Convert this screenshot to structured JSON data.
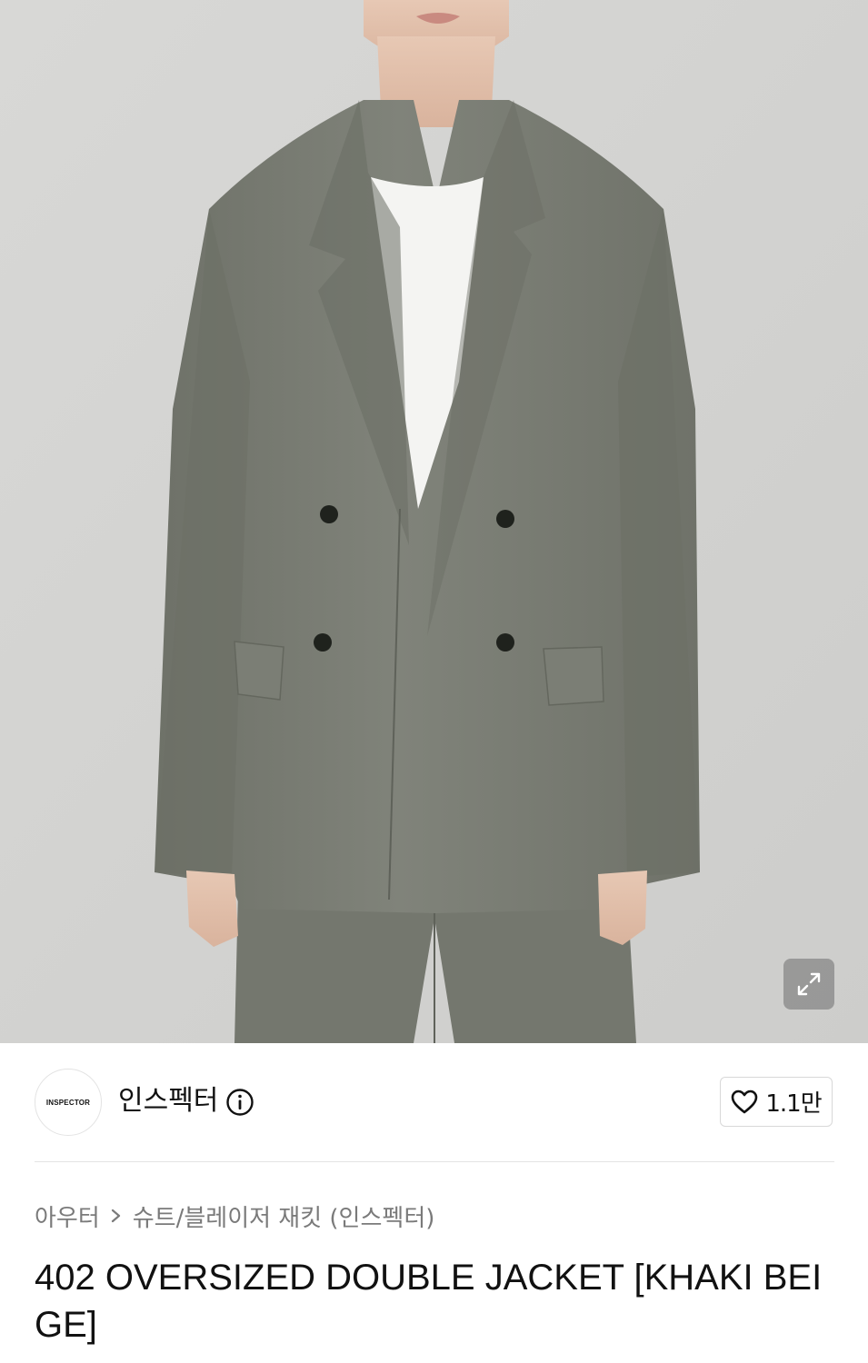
{
  "product": {
    "image_alt": "Model wearing khaki beige oversized double-breasted jacket",
    "expand_icon": "expand-icon"
  },
  "brand": {
    "logo_text": "INSPECTOR",
    "name": "인스펙터",
    "info_icon": "info-icon",
    "like_icon": "heart-icon",
    "like_count": "1.1만"
  },
  "breadcrumb": {
    "category": "아우터",
    "separator_icon": "chevron-right-icon",
    "subcategory": "슈트/블레이저 재킷 (인스펙터)"
  },
  "title": "402 OVERSIZED DOUBLE JACKET [KHAKI BEIGE]",
  "colors": {
    "jacket": "#7a7d73",
    "background": "#d3d3d1",
    "text_primary": "#111111",
    "text_secondary": "#7a7a7a"
  }
}
